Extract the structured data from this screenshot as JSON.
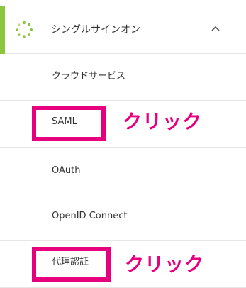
{
  "menu": {
    "header": {
      "label": "シングルサインオン",
      "icon": "spinner-icon",
      "expanded_icon": "chevron-up-icon",
      "accent_color": "#8cc63f"
    },
    "items": [
      {
        "label": "クラウドサービス"
      },
      {
        "label": "SAML"
      },
      {
        "label": "OAuth"
      },
      {
        "label": "OpenID Connect"
      },
      {
        "label": "代理認証"
      }
    ]
  },
  "annotations": {
    "color": "#e6007e",
    "callouts": [
      {
        "text": "クリック"
      },
      {
        "text": "クリック"
      }
    ]
  }
}
